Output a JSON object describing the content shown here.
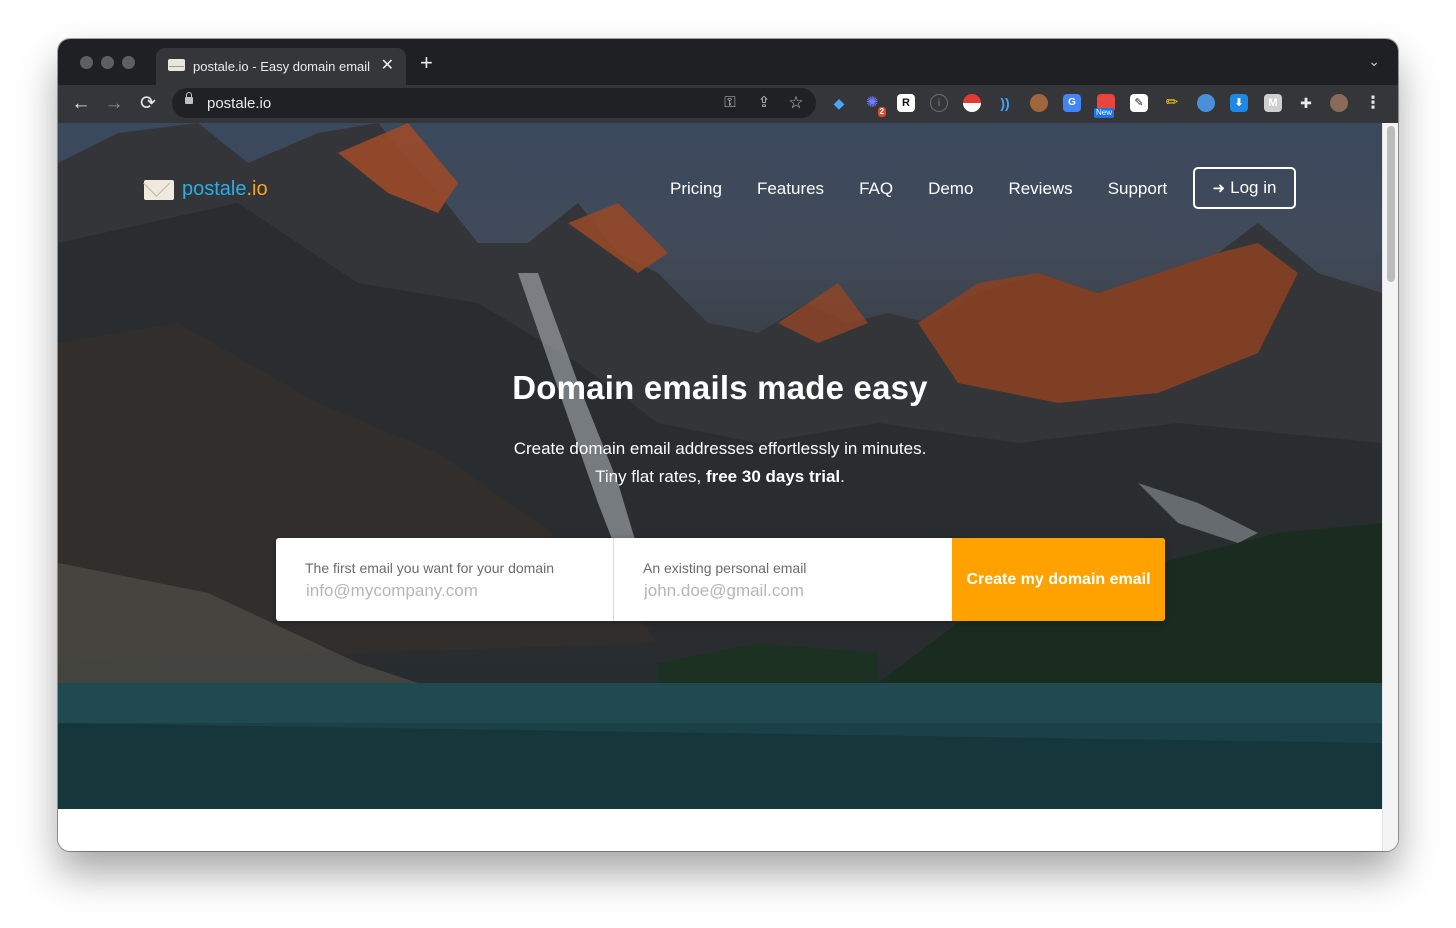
{
  "browser": {
    "tab_title": "postale.io - Easy domain email",
    "tab_close": "✕",
    "new_tab": "+",
    "tab_menu": "⌄",
    "url": "postale.io",
    "back": "←",
    "forward": "→",
    "reload": "⟳",
    "key_icon": "⚿",
    "share_icon": "⇪",
    "star_icon": "☆",
    "ext_badge_count": "2",
    "ext_new_badge": "New",
    "menu_icon": "⋮"
  },
  "nav": {
    "brand": "postale",
    "tld": ".io",
    "links": [
      "Pricing",
      "Features",
      "FAQ",
      "Demo",
      "Reviews",
      "Support"
    ],
    "login_label": "Log in",
    "login_icon": "➜"
  },
  "hero": {
    "headline": "Domain emails made easy",
    "sub_line1": "Create domain email addresses effortlessly in minutes.",
    "sub_line2_prefix": "Tiny flat rates, ",
    "sub_line2_bold": "free 30 days trial",
    "sub_line2_suffix": "."
  },
  "form": {
    "domain_label": "The first email you want for your domain",
    "domain_placeholder": "info@mycompany.com",
    "personal_label": "An existing personal email",
    "personal_placeholder": "john.doe@gmail.com",
    "cta_label": "Create my domain email"
  },
  "colors": {
    "brand_blue": "#29aee8",
    "brand_orange": "#f7a21b",
    "cta": "#ffa200"
  }
}
